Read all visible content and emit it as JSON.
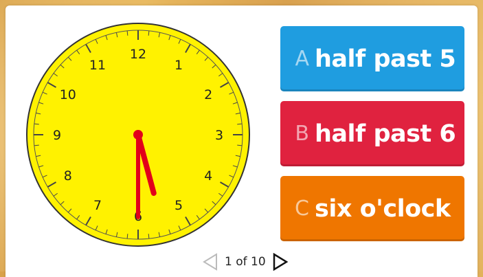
{
  "clock": {
    "numbers": [
      "12",
      "1",
      "2",
      "3",
      "4",
      "5",
      "6",
      "7",
      "8",
      "9",
      "10",
      "11"
    ],
    "face_color": "#fff200",
    "hand_color": "#e2001a",
    "time": "5:30"
  },
  "answers": [
    {
      "letter": "A",
      "text": "half past 5",
      "color": "#1f9de0"
    },
    {
      "letter": "B",
      "text": "half past 6",
      "color": "#e0223f"
    },
    {
      "letter": "C",
      "text": "six o'clock",
      "color": "#ef7600"
    }
  ],
  "pager": {
    "text": "1 of 10"
  }
}
